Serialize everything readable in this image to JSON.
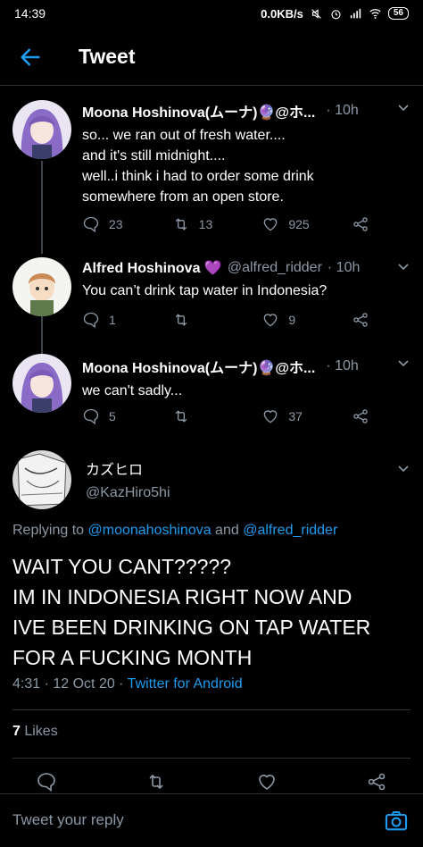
{
  "status_bar": {
    "time": "14:39",
    "speed": "0.0KB/s",
    "battery": "56"
  },
  "header": {
    "title": "Tweet"
  },
  "thread": [
    {
      "name": "Moona Hoshinova(ムーナ)🔮@ホ...",
      "handle": "",
      "time": "· 10h",
      "text": "so... we ran out of fresh water....\nand it's still midnight....\nwell..i think i had to order some drink\nsomewhere from an open store.",
      "replies": "23",
      "retweets": "13",
      "likes": "925"
    },
    {
      "name": "Alfred Hoshinova 💜",
      "handle": "@alfred_ridder",
      "time": "· 10h",
      "text": "You can’t drink tap water in Indonesia?",
      "replies": "1",
      "retweets": "",
      "likes": "9"
    },
    {
      "name": "Moona Hoshinova(ムーナ)🔮@ホ...",
      "handle": "",
      "time": "· 10h",
      "text": "we can't sadly...",
      "replies": "5",
      "retweets": "",
      "likes": "37"
    }
  ],
  "focus": {
    "name": "カズヒロ",
    "handle": "@KazHiro5hi",
    "replying_prefix": "Replying to ",
    "replying_user1": "@moonahoshinova",
    "replying_and": " and ",
    "replying_user2": "@alfred_ridder",
    "text": "WAIT YOU CANT?????\nIM IN INDONESIA RIGHT NOW AND\nIVE BEEN DRINKING ON TAP WATER\nFOR A FUCKING MONTH",
    "date": "4:31 · 12 Oct 20 · ",
    "client": "Twitter for Android",
    "likes_count": "7",
    "likes_label": " Likes"
  },
  "reply_bar": {
    "placeholder": "Tweet your reply"
  },
  "colors": {
    "accent": "#1d9bf0",
    "secondary_text": "#8b98a5",
    "background": "#000000"
  }
}
